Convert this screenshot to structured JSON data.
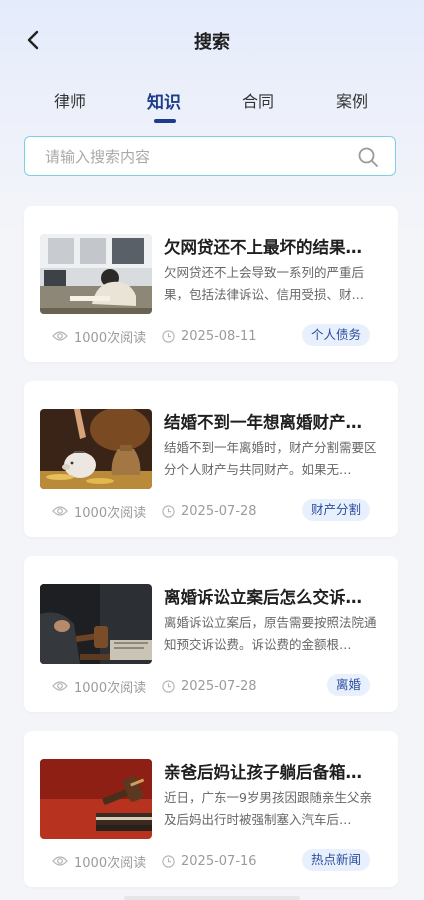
{
  "header": {
    "title": "搜索"
  },
  "tabs": [
    {
      "label": "律师",
      "active": false
    },
    {
      "label": "知识",
      "active": true
    },
    {
      "label": "合同",
      "active": false
    },
    {
      "label": "案例",
      "active": false
    }
  ],
  "search": {
    "placeholder": "请输入搜索内容",
    "value": ""
  },
  "articles": [
    {
      "title": "欠网贷还不上最坏的结果…",
      "summary": "欠网贷还不上会导致一系列的严重后果，包括法律诉讼、信用受损、财…",
      "views": "1000次阅读",
      "date": "2025-08-11",
      "tag": "个人债务",
      "thumbnail_icon": "office-worker-image"
    },
    {
      "title": "结婚不到一年想离婚财产…",
      "summary": "结婚不到一年离婚时，财产分割需要区分个人财产与共同财产。如果无…",
      "views": "1000次阅读",
      "date": "2025-07-28",
      "tag": "财产分割",
      "thumbnail_icon": "piggy-bank-image"
    },
    {
      "title": "离婚诉讼立案后怎么交诉…",
      "summary": "离婚诉讼立案后，原告需要按照法院通知预交诉讼费。诉讼费的金额根…",
      "views": "1000次阅读",
      "date": "2025-07-28",
      "tag": "离婚",
      "thumbnail_icon": "gavel-image"
    },
    {
      "title": "亲爸后妈让孩子躺后备箱…",
      "summary": "近日，广东一9岁男孩因跟随亲生父亲及后妈出行时被强制塞入汽车后…",
      "views": "1000次阅读",
      "date": "2025-07-16",
      "tag": "热点新闻",
      "thumbnail_icon": "gavel-on-book-image"
    }
  ],
  "colors": {
    "accent": "#1c3c8c",
    "search_border": "#7ecfe2",
    "tag_text": "#2c4d9e",
    "tag_bg": "#e9f0fd"
  }
}
